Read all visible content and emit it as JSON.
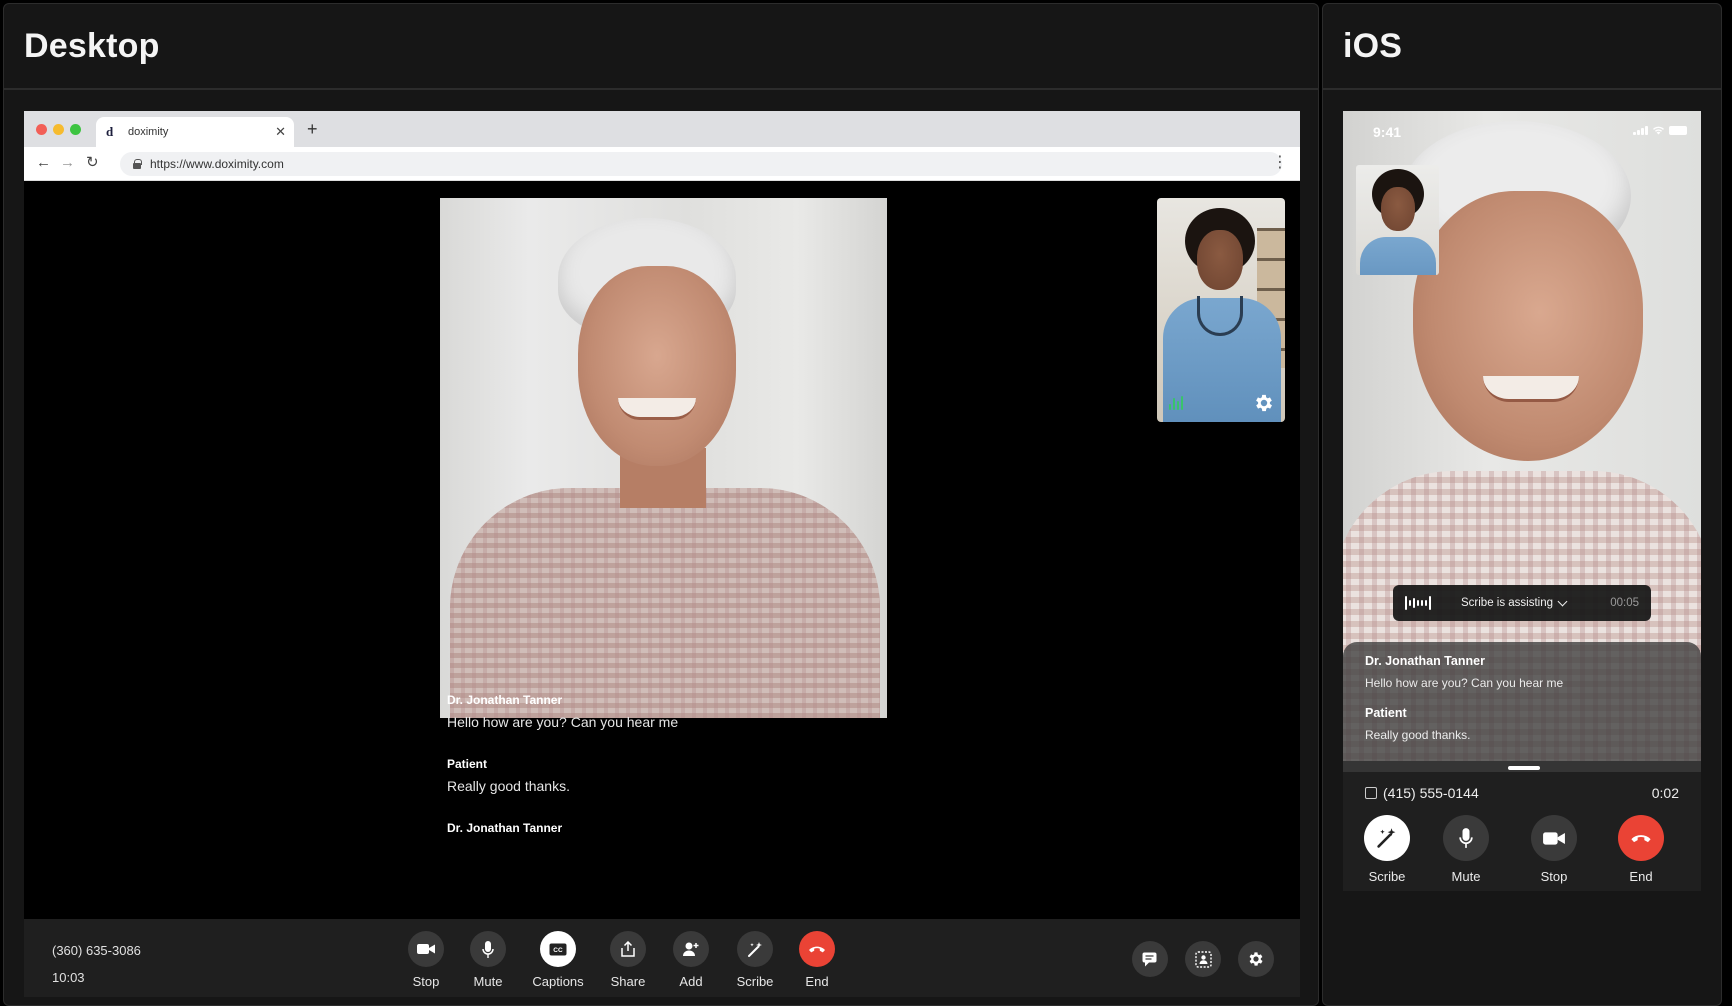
{
  "desktop": {
    "panel_title": "Desktop",
    "browser": {
      "tab_title": "doximity",
      "favicon_letter": "d",
      "url": "https://www.doximity.com"
    },
    "transcript": [
      {
        "speaker": "Dr. Jonathan Tanner",
        "text": "Hello how are you? Can you hear me"
      },
      {
        "speaker": "Patient",
        "text": "Really good thanks."
      },
      {
        "speaker": "Dr. Jonathan Tanner",
        "text": ""
      }
    ],
    "call": {
      "phone": "(360) 635-3086",
      "duration": "10:03"
    },
    "controls": [
      {
        "label": "Stop",
        "icon": "video-camera-icon"
      },
      {
        "label": "Mute",
        "icon": "microphone-icon"
      },
      {
        "label": "Captions",
        "icon": "captions-icon"
      },
      {
        "label": "Share",
        "icon": "share-icon"
      },
      {
        "label": "Add",
        "icon": "add-person-icon"
      },
      {
        "label": "Scribe",
        "icon": "scribe-wand-icon"
      },
      {
        "label": "End",
        "icon": "end-call-icon"
      }
    ],
    "right_controls": [
      "chat-icon",
      "participants-icon",
      "settings-gear-icon"
    ]
  },
  "ios": {
    "panel_title": "iOS",
    "status_time": "9:41",
    "scribe_pill": {
      "label": "Scribe is assisting",
      "timer": "00:05"
    },
    "transcript": [
      {
        "speaker": "Dr. Jonathan Tanner",
        "text": "Hello how are you? Can you hear me"
      },
      {
        "speaker": "Patient",
        "text": "Really good thanks."
      }
    ],
    "call": {
      "phone": "(415) 555-0144",
      "duration": "0:02"
    },
    "controls": [
      {
        "label": "Scribe",
        "icon": "scribe-wand-icon"
      },
      {
        "label": "Mute",
        "icon": "microphone-icon"
      },
      {
        "label": "Stop",
        "icon": "video-camera-icon"
      },
      {
        "label": "End",
        "icon": "end-call-icon"
      }
    ]
  },
  "colors": {
    "end_red": "#ea4335",
    "audio_green": "#39c46b",
    "panel_bg": "#161616"
  }
}
